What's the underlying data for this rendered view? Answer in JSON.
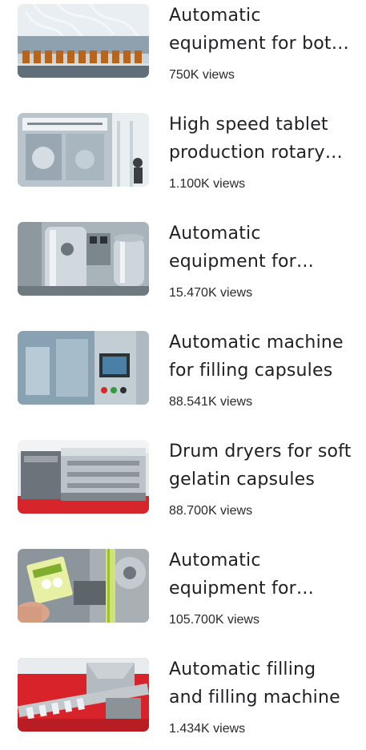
{
  "videos": [
    {
      "title": "Automatic equipment for bottle filling",
      "views": "750K views",
      "thumbnail_icon": "filling-line-photo-icon"
    },
    {
      "title": "High speed tablet production rotary press",
      "views": "1.100K views",
      "thumbnail_icon": "tablet-press-photo-icon"
    },
    {
      "title": "Automatic equipment for granulation",
      "views": "15.470K views",
      "thumbnail_icon": "steel-tank-photo-icon"
    },
    {
      "title": "Automatic machine for filling capsules",
      "views": "88.541K views",
      "thumbnail_icon": "control-panel-photo-icon"
    },
    {
      "title": "Drum dryers for soft gelatin capsules",
      "views": "88.700K views",
      "thumbnail_icon": "drum-dryer-photo-icon"
    },
    {
      "title": "Automatic equipment for sachet packing",
      "views": "105.700K views",
      "thumbnail_icon": "sachet-packing-photo-icon"
    },
    {
      "title": "Automatic filling and filling machine",
      "views": "1.434K views",
      "thumbnail_icon": "conveyor-photo-icon"
    }
  ]
}
